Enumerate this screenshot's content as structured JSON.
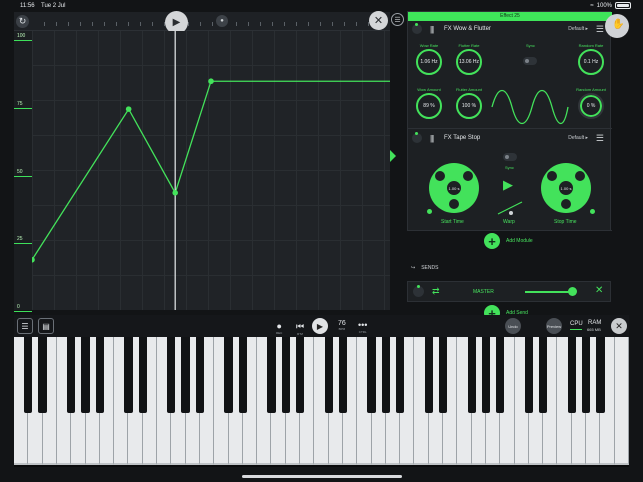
{
  "status_bar": {
    "time": "11:56",
    "date": "Tue 2 Jul",
    "battery": "100%"
  },
  "colors": {
    "accent": "#43e25b",
    "background": "#121416",
    "panel": "#1d2023"
  },
  "envelope": {
    "axis_labels": [
      "100",
      "75",
      "50",
      "25",
      "0"
    ],
    "points": [
      {
        "t": 0.0,
        "v": 0.18
      },
      {
        "t": 0.27,
        "v": 0.72
      },
      {
        "t": 0.4,
        "v": 0.42
      },
      {
        "t": 0.5,
        "v": 0.82
      },
      {
        "t": 1.0,
        "v": 0.82
      }
    ],
    "playhead": 0.4
  },
  "fx_panel": {
    "header": "Effect 25",
    "modules": [
      {
        "name": "FX Wow & Flutter",
        "preset": "Default",
        "knobs": [
          {
            "label": "Wow Rate",
            "value": "1.06 Hz"
          },
          {
            "label": "Flutter Rate",
            "value": "13.06 Hz"
          },
          {
            "label": "Random Rate",
            "value": "0.1 Hz"
          },
          {
            "label": "Wow Amount",
            "value": "89 %"
          },
          {
            "label": "Flutter Amount",
            "value": "100 %"
          },
          {
            "label": "Random Amount",
            "value": "0 %"
          }
        ],
        "sync_label": "Sync"
      },
      {
        "name": "FX Tape Stop",
        "preset": "Default",
        "start_time": {
          "label": "Start Time",
          "value": "1.00 s"
        },
        "stop_time": {
          "label": "Stop Time",
          "value": "1.00 s"
        },
        "sync_label": "Sync",
        "warp_label": "Warp"
      }
    ],
    "add_module": "Add Module"
  },
  "sends": {
    "title": "SENDS",
    "items": [
      {
        "name": "MASTER",
        "level": 0.85
      }
    ],
    "add_send": "Add Send"
  },
  "transport": {
    "rec_caption": "REC",
    "rtz_caption": "RTZ",
    "bpm_value": "76",
    "bpm_caption": "BPM",
    "ctrl_caption": "CTRL",
    "undo": "Undo",
    "preview": "Preview",
    "cpu": "CPU",
    "ram_label": "RAM",
    "ram_value": "665 MB"
  },
  "keyboard": {
    "white_key_count": 43
  }
}
